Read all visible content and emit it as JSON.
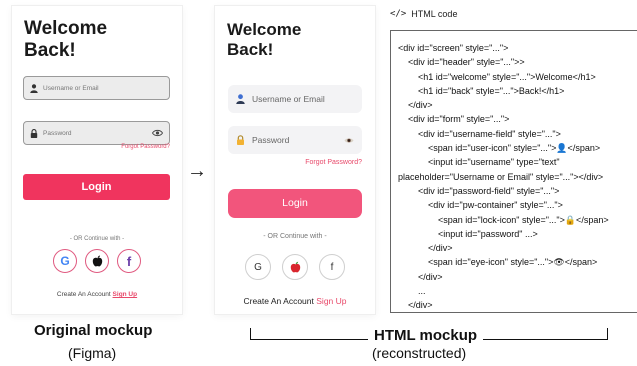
{
  "original": {
    "welcome": "Welcome",
    "back": "Back!",
    "username_placeholder": "Username or Email",
    "password_placeholder": "Password",
    "forgot": "Forgot Password?",
    "login": "Login",
    "or_continue": "- OR Continue with -",
    "create_account": "Create An Account",
    "sign_up": "Sign Up",
    "social_google": "G",
    "social_facebook": "f",
    "caption_title": "Original mockup",
    "caption_sub": "(Figma)"
  },
  "reconstructed": {
    "welcome": "Welcome",
    "back": "Back!",
    "username_placeholder": "Username or Email",
    "password_placeholder": "Password",
    "forgot": "Forgot Password?",
    "login": "Login",
    "or_continue": "- OR Continue with -",
    "create_account": "Create An Account",
    "sign_up": "Sign Up",
    "social_google": "G",
    "social_facebook": "f",
    "caption_title": "HTML mockup",
    "caption_sub": "(reconstructed)"
  },
  "arrow": "→",
  "code": {
    "title": "HTML code",
    "icon": "</>",
    "lines": [
      "<div id=\"screen\" style=\"...\">",
      "    <div id=\"header\" style=\"...\">>",
      "        <h1 id=\"welcome\" style=\"...\">Welcome</h1>",
      "        <h1 id=\"back\" style=\"...\">Back!</h1>",
      "    </div>",
      "    <div id=\"form\" style=\"...\">",
      "        <div id=\"username-field\" style=\"...\">",
      "            <span id=\"user-icon\" style=\"...\">👤</span>",
      "            <input id=\"username\" type=\"text\"",
      "placeholder=\"Username or Email\" style=\"...\"></div>",
      "        <div id=\"password-field\" style=\"...\">",
      "            <div id=\"pw-container\" style=\"...\">",
      "                <span id=\"lock-icon\" style=\"...\">🔒</span>",
      "                <input id=\"password\" ...>",
      "            </div>",
      "            <span id=\"eye-icon\" style=\"...\">👁</span>",
      "        </div>",
      "        ...",
      "    </div>",
      "</div>"
    ]
  },
  "colors": {
    "accent": "#f0345e",
    "accent_soft": "#f2557c",
    "link": "#e8496a"
  }
}
